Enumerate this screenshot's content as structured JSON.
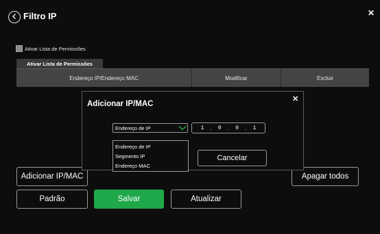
{
  "window": {
    "title": "Filtro IP"
  },
  "permissions": {
    "checkbox_label": "Ativar Lista de Permissões"
  },
  "tabs": [
    {
      "label": "Ativar Lista de Permissões"
    }
  ],
  "table": {
    "columns": [
      "Endereço IP/Endereço MAC",
      "Modificar",
      "Excluir"
    ]
  },
  "buttons": {
    "add": "Adicionar IP/MAC",
    "clear_all": "Apagar todos",
    "default": "Padrão",
    "save": "Salvar",
    "update": "Atualizar"
  },
  "modal": {
    "title": "Adicionar IP/MAC",
    "select_value": "Endereço de IP",
    "ip_octets": [
      "1",
      "0",
      "0",
      "1"
    ],
    "dropdown_options": [
      "Endereço de IP",
      "Segmento IP",
      "Endereço MAC"
    ],
    "cancel": "Cancelar"
  },
  "colors": {
    "background": "#0d0d0d",
    "accent_green": "#1fa84a",
    "header_gray": "#444444"
  },
  "icons": {
    "back": "back-arrow-icon",
    "close": "close-icon",
    "chevron": "chevron-down-icon"
  }
}
